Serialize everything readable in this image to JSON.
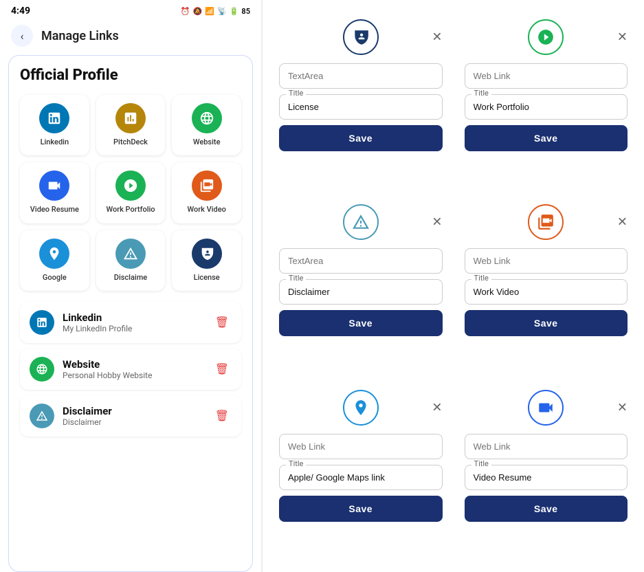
{
  "statusBar": {
    "time": "4:49",
    "battery": "85"
  },
  "header": {
    "backLabel": "‹",
    "title": "Manage Links"
  },
  "officialProfile": {
    "cardTitle": "Official Profile",
    "icons": [
      {
        "id": "linkedin",
        "label": "Linkedin",
        "bg": "bg-linkedin",
        "icon": "in"
      },
      {
        "id": "pitchdeck",
        "label": "PitchDeck",
        "bg": "bg-pitchdeck",
        "icon": "🎯"
      },
      {
        "id": "website",
        "label": "Website",
        "bg": "bg-website",
        "icon": "🌐"
      },
      {
        "id": "videoresume",
        "label": "Video Resume",
        "bg": "bg-videoresume",
        "icon": "▶"
      },
      {
        "id": "workportfolio",
        "label": "Work Portfolio",
        "bg": "bg-workportfolio",
        "icon": "📁"
      },
      {
        "id": "workvideo",
        "label": "Work Video",
        "bg": "bg-workvideo",
        "icon": "🎥"
      },
      {
        "id": "google",
        "label": "Google",
        "bg": "bg-google",
        "icon": "➤"
      },
      {
        "id": "disclaimer",
        "label": "Disclaime",
        "bg": "bg-disclaimer",
        "icon": "⚠"
      },
      {
        "id": "license",
        "label": "License",
        "bg": "bg-license",
        "icon": "🪪"
      }
    ],
    "links": [
      {
        "id": "linkedin-link",
        "name": "Linkedin",
        "sub": "My LinkedIn Profile",
        "bg": "bg-linkedin",
        "icon": "in"
      },
      {
        "id": "website-link",
        "name": "Website",
        "sub": "Personal Hobby Website",
        "bg": "bg-website",
        "icon": "🌐"
      },
      {
        "id": "disclaimer-link",
        "name": "Disclaimer",
        "sub": "Disclaimer",
        "bg": "bg-disclaimer",
        "icon": "⚠"
      }
    ]
  },
  "rightPanel": {
    "cards": [
      {
        "id": "license-card",
        "iconStyle": "license-style",
        "iconChar": "🪪",
        "textarea": {
          "placeholder": "TextArea",
          "value": ""
        },
        "title": {
          "label": "Title",
          "value": "License"
        },
        "saveLabel": "Save"
      },
      {
        "id": "workportfolio-card",
        "iconStyle": "portfolio-style",
        "iconChar": "📁",
        "textarea": {
          "placeholder": "Web Link",
          "value": ""
        },
        "title": {
          "label": "Title",
          "value": "Work Portfolio"
        },
        "saveLabel": "Save"
      },
      {
        "id": "disclaimer-card",
        "iconStyle": "disclaimer-style",
        "iconChar": "⚠",
        "textarea": {
          "placeholder": "TextArea",
          "value": ""
        },
        "title": {
          "label": "Title",
          "value": "Disclaimer"
        },
        "saveLabel": "Save"
      },
      {
        "id": "workvideo-card",
        "iconStyle": "workvideo-style",
        "iconChar": "🎥",
        "textarea": {
          "placeholder": "Web Link",
          "value": ""
        },
        "title": {
          "label": "Title",
          "value": "Work Video"
        },
        "saveLabel": "Save"
      },
      {
        "id": "google-card",
        "iconStyle": "google-style",
        "iconChar": "➤",
        "textarea": {
          "placeholder": "Web Link",
          "value": ""
        },
        "title": {
          "label": "Title",
          "value": "Apple/ Google Maps link"
        },
        "saveLabel": "Save"
      },
      {
        "id": "videoresume-card",
        "iconStyle": "videoresume-style",
        "iconChar": "▶",
        "textarea": {
          "placeholder": "Web Link",
          "value": ""
        },
        "title": {
          "label": "Title",
          "value": "Video Resume"
        },
        "saveLabel": "Save"
      }
    ]
  }
}
